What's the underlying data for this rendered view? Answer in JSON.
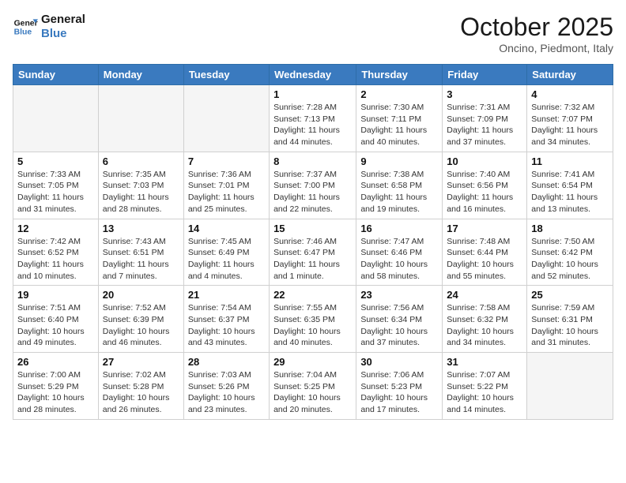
{
  "header": {
    "logo_general": "General",
    "logo_blue": "Blue",
    "month_title": "October 2025",
    "subtitle": "Oncino, Piedmont, Italy"
  },
  "days_of_week": [
    "Sunday",
    "Monday",
    "Tuesday",
    "Wednesday",
    "Thursday",
    "Friday",
    "Saturday"
  ],
  "weeks": [
    [
      {
        "day": "",
        "empty": true
      },
      {
        "day": "",
        "empty": true
      },
      {
        "day": "",
        "empty": true
      },
      {
        "day": "1",
        "sunrise": "7:28 AM",
        "sunset": "7:13 PM",
        "daylight": "11 hours and 44 minutes."
      },
      {
        "day": "2",
        "sunrise": "7:30 AM",
        "sunset": "7:11 PM",
        "daylight": "11 hours and 40 minutes."
      },
      {
        "day": "3",
        "sunrise": "7:31 AM",
        "sunset": "7:09 PM",
        "daylight": "11 hours and 37 minutes."
      },
      {
        "day": "4",
        "sunrise": "7:32 AM",
        "sunset": "7:07 PM",
        "daylight": "11 hours and 34 minutes."
      }
    ],
    [
      {
        "day": "5",
        "sunrise": "7:33 AM",
        "sunset": "7:05 PM",
        "daylight": "11 hours and 31 minutes."
      },
      {
        "day": "6",
        "sunrise": "7:35 AM",
        "sunset": "7:03 PM",
        "daylight": "11 hours and 28 minutes."
      },
      {
        "day": "7",
        "sunrise": "7:36 AM",
        "sunset": "7:01 PM",
        "daylight": "11 hours and 25 minutes."
      },
      {
        "day": "8",
        "sunrise": "7:37 AM",
        "sunset": "7:00 PM",
        "daylight": "11 hours and 22 minutes."
      },
      {
        "day": "9",
        "sunrise": "7:38 AM",
        "sunset": "6:58 PM",
        "daylight": "11 hours and 19 minutes."
      },
      {
        "day": "10",
        "sunrise": "7:40 AM",
        "sunset": "6:56 PM",
        "daylight": "11 hours and 16 minutes."
      },
      {
        "day": "11",
        "sunrise": "7:41 AM",
        "sunset": "6:54 PM",
        "daylight": "11 hours and 13 minutes."
      }
    ],
    [
      {
        "day": "12",
        "sunrise": "7:42 AM",
        "sunset": "6:52 PM",
        "daylight": "11 hours and 10 minutes."
      },
      {
        "day": "13",
        "sunrise": "7:43 AM",
        "sunset": "6:51 PM",
        "daylight": "11 hours and 7 minutes."
      },
      {
        "day": "14",
        "sunrise": "7:45 AM",
        "sunset": "6:49 PM",
        "daylight": "11 hours and 4 minutes."
      },
      {
        "day": "15",
        "sunrise": "7:46 AM",
        "sunset": "6:47 PM",
        "daylight": "11 hours and 1 minute."
      },
      {
        "day": "16",
        "sunrise": "7:47 AM",
        "sunset": "6:46 PM",
        "daylight": "10 hours and 58 minutes."
      },
      {
        "day": "17",
        "sunrise": "7:48 AM",
        "sunset": "6:44 PM",
        "daylight": "10 hours and 55 minutes."
      },
      {
        "day": "18",
        "sunrise": "7:50 AM",
        "sunset": "6:42 PM",
        "daylight": "10 hours and 52 minutes."
      }
    ],
    [
      {
        "day": "19",
        "sunrise": "7:51 AM",
        "sunset": "6:40 PM",
        "daylight": "10 hours and 49 minutes."
      },
      {
        "day": "20",
        "sunrise": "7:52 AM",
        "sunset": "6:39 PM",
        "daylight": "10 hours and 46 minutes."
      },
      {
        "day": "21",
        "sunrise": "7:54 AM",
        "sunset": "6:37 PM",
        "daylight": "10 hours and 43 minutes."
      },
      {
        "day": "22",
        "sunrise": "7:55 AM",
        "sunset": "6:35 PM",
        "daylight": "10 hours and 40 minutes."
      },
      {
        "day": "23",
        "sunrise": "7:56 AM",
        "sunset": "6:34 PM",
        "daylight": "10 hours and 37 minutes."
      },
      {
        "day": "24",
        "sunrise": "7:58 AM",
        "sunset": "6:32 PM",
        "daylight": "10 hours and 34 minutes."
      },
      {
        "day": "25",
        "sunrise": "7:59 AM",
        "sunset": "6:31 PM",
        "daylight": "10 hours and 31 minutes."
      }
    ],
    [
      {
        "day": "26",
        "sunrise": "7:00 AM",
        "sunset": "5:29 PM",
        "daylight": "10 hours and 28 minutes."
      },
      {
        "day": "27",
        "sunrise": "7:02 AM",
        "sunset": "5:28 PM",
        "daylight": "10 hours and 26 minutes."
      },
      {
        "day": "28",
        "sunrise": "7:03 AM",
        "sunset": "5:26 PM",
        "daylight": "10 hours and 23 minutes."
      },
      {
        "day": "29",
        "sunrise": "7:04 AM",
        "sunset": "5:25 PM",
        "daylight": "10 hours and 20 minutes."
      },
      {
        "day": "30",
        "sunrise": "7:06 AM",
        "sunset": "5:23 PM",
        "daylight": "10 hours and 17 minutes."
      },
      {
        "day": "31",
        "sunrise": "7:07 AM",
        "sunset": "5:22 PM",
        "daylight": "10 hours and 14 minutes."
      },
      {
        "day": "",
        "empty": true
      }
    ]
  ]
}
